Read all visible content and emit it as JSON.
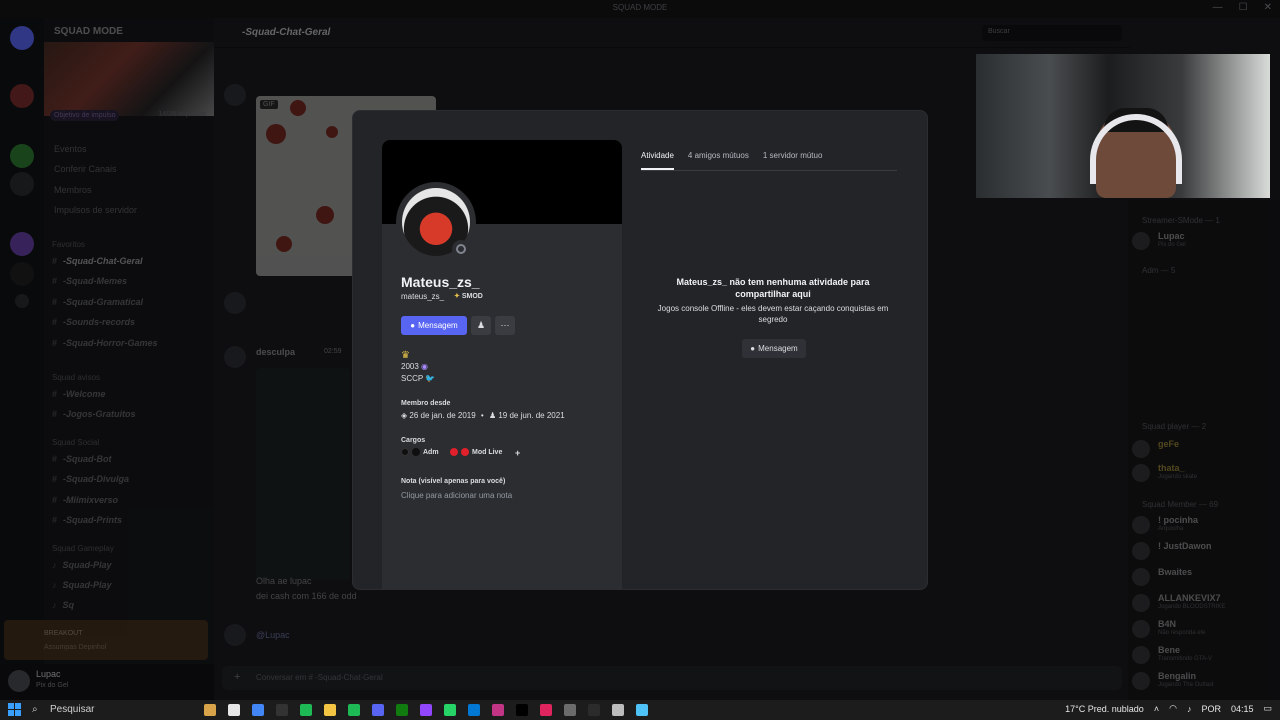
{
  "window": {
    "title": "SQUAD MODE"
  },
  "server": {
    "name": "SQUAD MODE",
    "boost_goal": "Objetivo de impulso",
    "boost_count": "14/28 Impulsos",
    "menu": [
      "Eventos",
      "Conferir Canais",
      "Membros",
      "Impulsos de servidor"
    ],
    "category_favoritos": "Favoritos",
    "channels_fav": [
      "-Squad-Chat-Geral",
      "-Squad-Memes",
      "-Squad-Gramatical",
      "-Sounds-records",
      "-Squad-Horror-Games"
    ],
    "category_avisos": "Squad avisos",
    "channels_avisos": [
      "-Welcome",
      "-Jogos-Gratuitos"
    ],
    "category_social": "Squad Social",
    "channels_social": [
      "-Squad-Bot",
      "-Squad-Divulga",
      "-Miimixverso",
      "-Squad-Prints"
    ],
    "category_gameplay": "Squad Gameplay",
    "channels_gameplay": [
      "Squad-Play",
      "Squad-Play",
      "Sq"
    ]
  },
  "voice": {
    "line1": "BREAKOUT",
    "line2": "Assumpas Depinhol"
  },
  "user": {
    "name": "Lupac",
    "status": "Pix do Gel"
  },
  "chat": {
    "channel": "-Squad-Chat-Geral",
    "search_placeholder": "Buscar",
    "gif_badge": "GIF",
    "msg_author": "desculpa",
    "msg_time": "02:59",
    "line1": "Olha ae lupac",
    "line2": "dei cash com 166 de odd",
    "mention": "@Lupac",
    "composer_placeholder": "Conversar em # -Squad-Chat-Geral"
  },
  "members": {
    "group1": "Streamer-SMode — 1",
    "group2": "Adm — 5",
    "group3": "Squad player — 2",
    "group4": "Squad Member — 69",
    "list": [
      {
        "name": "Lupac",
        "status": "Pix do Gel"
      },
      {
        "name": "geFe",
        "status": ""
      },
      {
        "name": "thata_",
        "status": "Jogando skate"
      },
      {
        "name": "! pocinha",
        "status": "Arquiolha"
      },
      {
        "name": "! JustDawon",
        "status": ""
      },
      {
        "name": "Bwaites",
        "status": ""
      },
      {
        "name": "ALLANKEVIX7",
        "status": "Jogando BLOODSTRIKE"
      },
      {
        "name": "B4N",
        "status": "Não responda ele"
      },
      {
        "name": "Bene",
        "status": "Transmitindo GTA-V"
      },
      {
        "name": "Bengalin",
        "status": "Jogando The Outlast"
      }
    ]
  },
  "profile": {
    "display_name": "Mateus_zs_",
    "username": "mateus_zs_",
    "tag": "SMOD",
    "message_button": "Mensagem",
    "bio_line1": "2003",
    "bio_line2": "SCCP",
    "member_since_title": "Membro desde",
    "discord_since": "26 de jan. de 2019",
    "server_since": "19 de jun. de 2021",
    "roles_title": "Cargos",
    "roles": [
      "Adm",
      "Mod Live"
    ],
    "note_title": "Nota (visível apenas para você)",
    "note_placeholder": "Clique para adicionar uma nota",
    "tabs": [
      "Atividade",
      "4 amigos mútuos",
      "1 servidor mútuo"
    ],
    "activity_empty_title": "Mateus_zs_ não tem nenhuma atividade para compartilhar aqui",
    "activity_empty_sub": "Jogos console Offline - eles devem estar caçando conquistas em segredo",
    "activity_message_button": "Mensagem"
  },
  "taskbar": {
    "search": "Pesquisar",
    "weather": "17°C  Pred. nublado",
    "lang": "POR",
    "time": "04:15"
  },
  "colors": {
    "blurple": "#5865f2",
    "role_adm": "#1e1f22",
    "role_mod": "#e0202b"
  }
}
